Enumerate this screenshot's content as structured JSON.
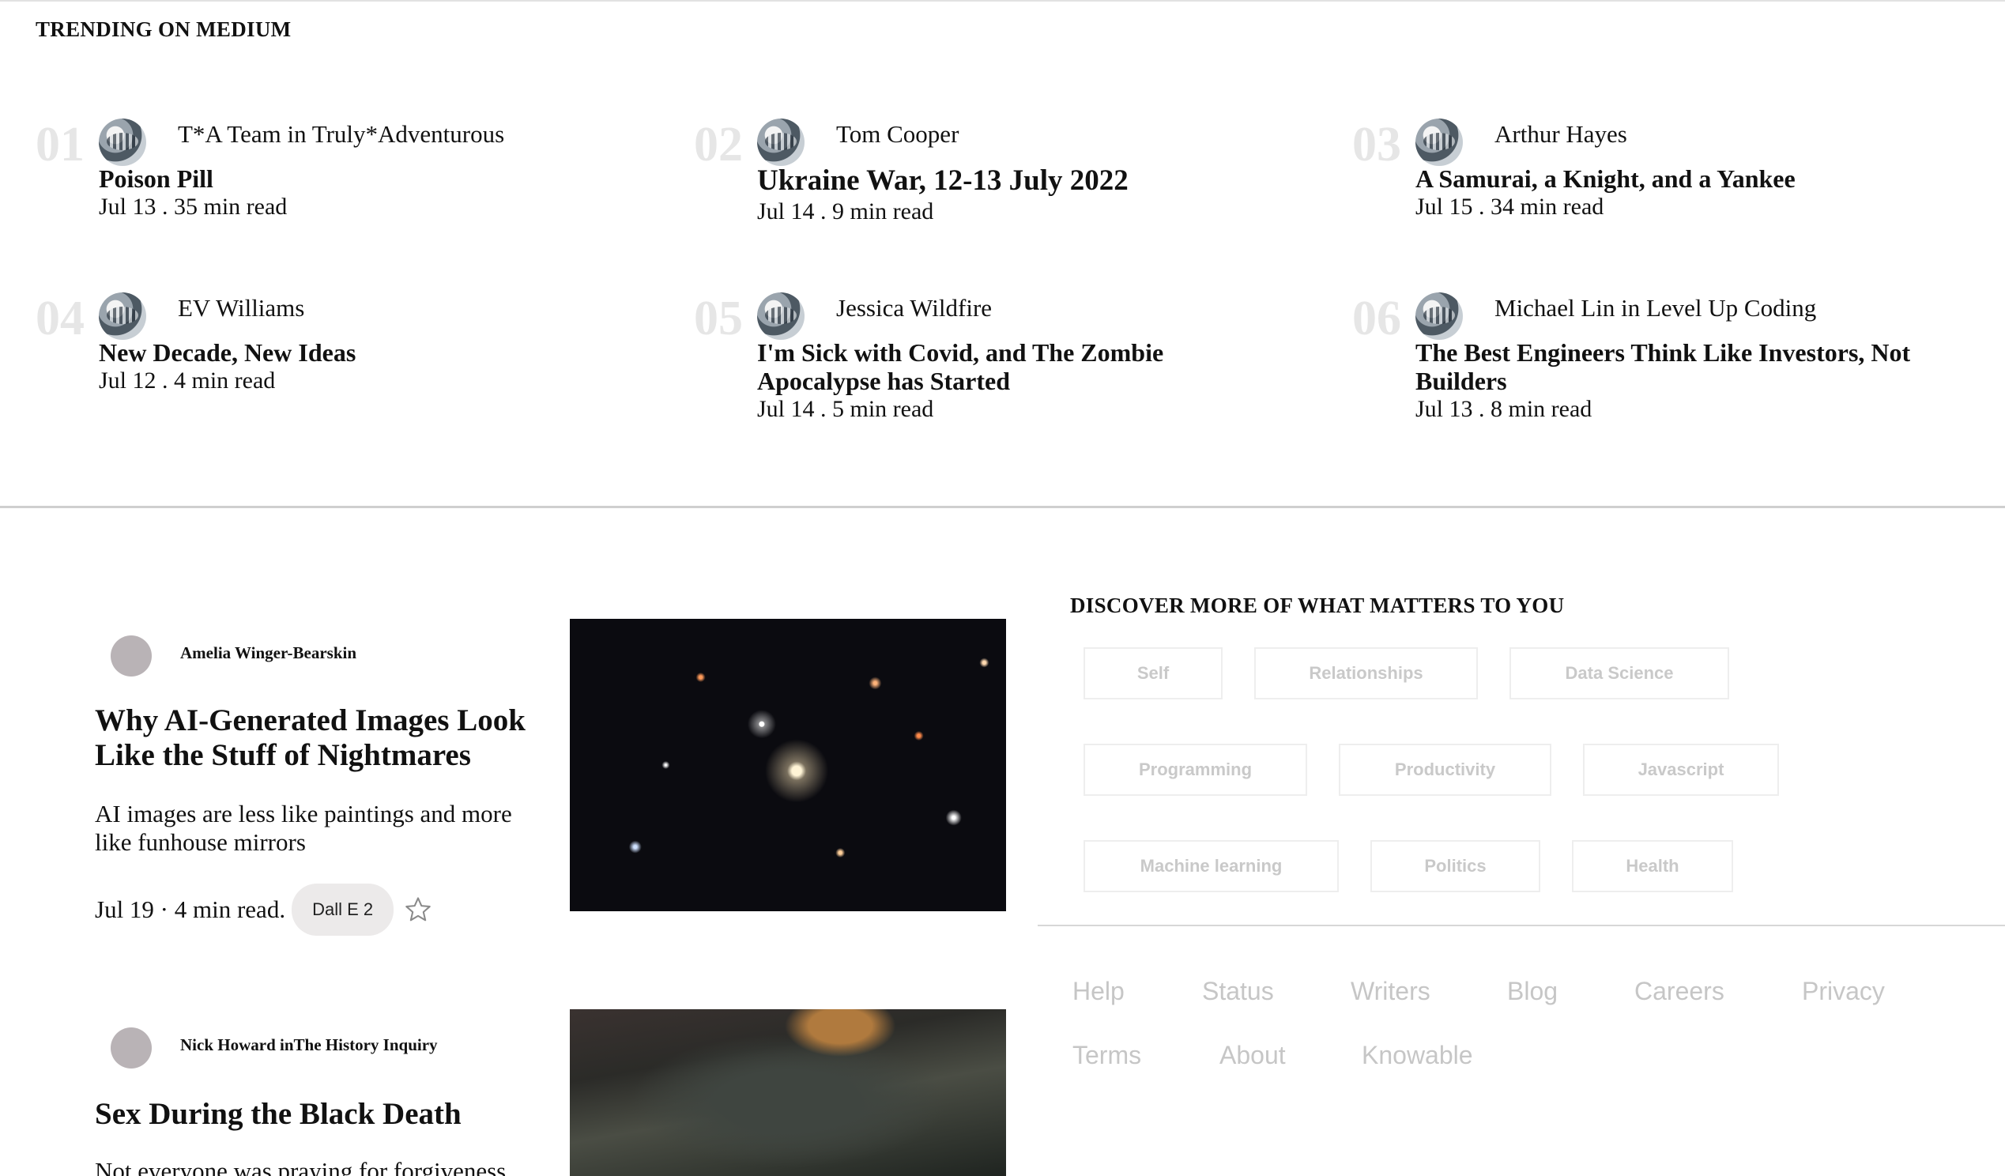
{
  "trending": {
    "heading": "TRENDING ON MEDIUM",
    "items": [
      {
        "num": "01",
        "author": "T*A Team in Truly*Adventurous",
        "title": "Poison Pill",
        "meta": "Jul 13 . 35 min read"
      },
      {
        "num": "02",
        "author": "Tom Cooper",
        "title": "Ukraine War, 12-13 July 2022",
        "meta": "Jul 14 . 9 min read"
      },
      {
        "num": "03",
        "author": "Arthur Hayes",
        "title": "A Samurai, a Knight, and a Yankee",
        "meta": "Jul 15 . 34 min read"
      },
      {
        "num": "04",
        "author": "EV Williams",
        "title": "New Decade, New Ideas",
        "meta": "Jul 12 . 4 min read"
      },
      {
        "num": "05",
        "author": "Jessica Wildfire",
        "title": "I'm Sick with Covid, and The Zombie Apocalypse has Started",
        "meta": "Jul 14 . 5 min read"
      },
      {
        "num": "06",
        "author": "Michael Lin in Level Up Coding",
        "title": "The Best Engineers Think Like Investors, Not Builders",
        "meta": "Jul 13 . 8 min read"
      }
    ]
  },
  "feed": [
    {
      "author": "Amelia Winger-Bearskin",
      "title": "Why AI-Generated Images Look Like the Stuff of Nightmares",
      "subtitle": "AI images are less like paintings and more like funhouse mirrors",
      "meta": "Jul 19 · 4 min read.",
      "tag": "Dall E 2"
    },
    {
      "author": "Nick Howard inThe History Inquiry",
      "title": "Sex During the Black Death",
      "subtitle": "Not everyone was praying for forgiveness"
    }
  ],
  "discover": {
    "heading": "DISCOVER MORE OF WHAT MATTERS TO YOU",
    "topics": [
      "Self",
      "Relationships",
      "Data Science",
      "Programming",
      "Productivity",
      "Javascript",
      "Machine learning",
      "Politics",
      "Health"
    ]
  },
  "footer": {
    "links": [
      "Help",
      "Status",
      "Writers",
      "Blog",
      "Careers",
      "Privacy",
      "Terms",
      "About",
      "Knowable"
    ]
  },
  "colors": {
    "rank_number": "#e6e6e6",
    "topic_text": "#c9c9c9",
    "footer_text": "#c6c6c6",
    "tag_bg": "#eceaea"
  }
}
